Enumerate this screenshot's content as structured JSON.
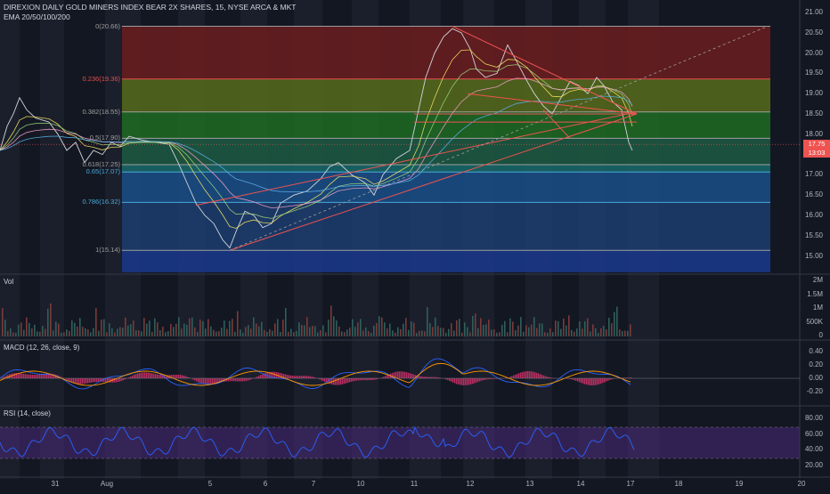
{
  "header": {
    "title": "DIREXION DAILY GOLD MINERS INDEX BEAR 2X SHARES, 15, NYSE ARCA & MKT",
    "indicator": "EMA 20/50/100/200"
  },
  "fib_levels": [
    {
      "label": "0(20.66)",
      "price": 20.66,
      "color": "#9e9e9e",
      "zone": "#6b1d1f"
    },
    {
      "label": "0.236(19.36)",
      "price": 19.36,
      "color": "#e05050",
      "zone": "#566b1a"
    },
    {
      "label": "0.382(18.55)",
      "price": 18.55,
      "color": "#9e9e9e",
      "zone": "#1f6b22"
    },
    {
      "label": "0.5(17.90)",
      "price": 17.9,
      "color": "#9e9e9e",
      "zone": "#1c5a42"
    },
    {
      "label": "0.618(17.25)",
      "price": 17.25,
      "color": "#9e9e9e",
      "zone": "#176a6a"
    },
    {
      "label": "0.65(17.07)",
      "price": 17.07,
      "color": "#4aa8d8",
      "zone": "#1a4f88"
    },
    {
      "label": "0.786(16.32)",
      "price": 16.32,
      "color": "#4aa8d8",
      "zone": "#1c3d6e"
    },
    {
      "label": "1(15.14)",
      "price": 15.14,
      "color": "#9e9e9e",
      "zone": "#1a3a8c"
    }
  ],
  "price_axis": [
    "21.00",
    "20.50",
    "20.00",
    "19.50",
    "19.00",
    "18.50",
    "18.00",
    "17.50",
    "17.00",
    "16.50",
    "16.00",
    "15.50",
    "15.00"
  ],
  "price_tags": [
    {
      "text": "17.75",
      "color": "#ef5350"
    },
    {
      "text": "13:03",
      "color": "#ef5350"
    }
  ],
  "volume": {
    "label": "Vol",
    "axis": [
      "2M",
      "1.5M",
      "1M",
      "500K",
      "0"
    ]
  },
  "macd": {
    "label": "MACD (12, 26, close, 9)",
    "axis": [
      "0.40",
      "0.20",
      "0.00",
      "-0.20"
    ]
  },
  "rsi": {
    "label": "RSI (14, close)",
    "axis": [
      "80.00",
      "60.00",
      "40.00",
      "20.00"
    ]
  },
  "time_axis": [
    "31",
    "Aug",
    "5",
    "6",
    "7",
    "10",
    "11",
    "12",
    "13",
    "14",
    "17",
    "18",
    "19",
    "20"
  ],
  "colors": {
    "background": "#131722",
    "candle_up": "#26a69a",
    "candle_down": "#ef5350",
    "trend": "#ef5350"
  }
}
